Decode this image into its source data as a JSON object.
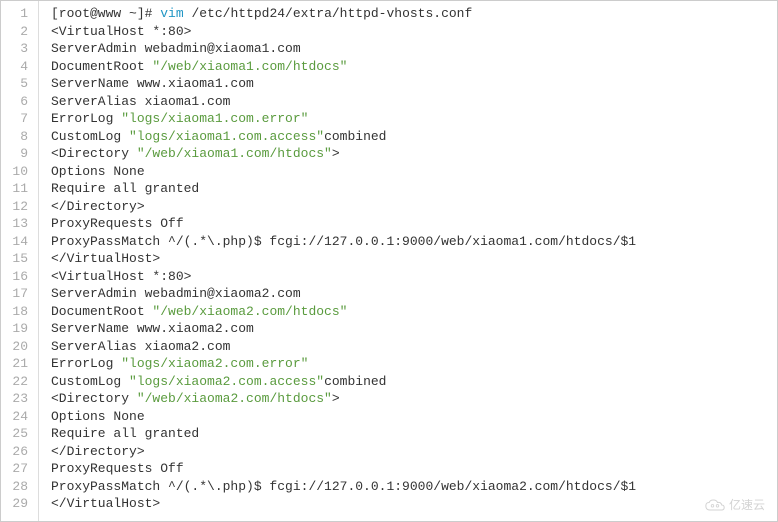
{
  "watermark": "亿速云",
  "lines": [
    {
      "num": 1,
      "segments": [
        {
          "cls": "prompt",
          "text": "[root@www ~]#"
        },
        {
          "cls": "",
          "text": " "
        },
        {
          "cls": "cmd-vim",
          "text": "vim"
        },
        {
          "cls": "",
          "text": " /etc/httpd24/extra/httpd-vhosts.conf"
        }
      ]
    },
    {
      "num": 2,
      "segments": [
        {
          "cls": "",
          "text": "<VirtualHost *:80>"
        }
      ]
    },
    {
      "num": 3,
      "segments": [
        {
          "cls": "",
          "text": "ServerAdmin webadmin@xiaoma1.com"
        }
      ]
    },
    {
      "num": 4,
      "segments": [
        {
          "cls": "",
          "text": "DocumentRoot "
        },
        {
          "cls": "string-green",
          "text": "\"/web/xiaoma1.com/htdocs\""
        }
      ]
    },
    {
      "num": 5,
      "segments": [
        {
          "cls": "",
          "text": "ServerName www.xiaoma1.com"
        }
      ]
    },
    {
      "num": 6,
      "segments": [
        {
          "cls": "",
          "text": "ServerAlias xiaoma1.com"
        }
      ]
    },
    {
      "num": 7,
      "segments": [
        {
          "cls": "",
          "text": "ErrorLog "
        },
        {
          "cls": "string-green",
          "text": "\"logs/xiaoma1.com.error\""
        }
      ]
    },
    {
      "num": 8,
      "segments": [
        {
          "cls": "",
          "text": "CustomLog "
        },
        {
          "cls": "string-green",
          "text": "\"logs/xiaoma1.com.access\""
        },
        {
          "cls": "",
          "text": "combined"
        }
      ]
    },
    {
      "num": 9,
      "segments": [
        {
          "cls": "",
          "text": "<Directory "
        },
        {
          "cls": "string-green",
          "text": "\"/web/xiaoma1.com/htdocs\""
        },
        {
          "cls": "",
          "text": ">"
        }
      ]
    },
    {
      "num": 10,
      "segments": [
        {
          "cls": "",
          "text": "Options None"
        }
      ]
    },
    {
      "num": 11,
      "segments": [
        {
          "cls": "",
          "text": "Require all granted"
        }
      ]
    },
    {
      "num": 12,
      "segments": [
        {
          "cls": "",
          "text": "</Directory>"
        }
      ]
    },
    {
      "num": 13,
      "segments": [
        {
          "cls": "",
          "text": "ProxyRequests Off"
        }
      ]
    },
    {
      "num": 14,
      "segments": [
        {
          "cls": "",
          "text": "ProxyPassMatch ^/(.*\\.php)$ fcgi://127.0.0.1:9000/web/xiaoma1.com/htdocs/$1"
        }
      ]
    },
    {
      "num": 15,
      "segments": [
        {
          "cls": "",
          "text": "</VirtualHost>"
        }
      ]
    },
    {
      "num": 16,
      "segments": [
        {
          "cls": "",
          "text": "<VirtualHost *:80>"
        }
      ]
    },
    {
      "num": 17,
      "segments": [
        {
          "cls": "",
          "text": "ServerAdmin webadmin@xiaoma2.com"
        }
      ]
    },
    {
      "num": 18,
      "segments": [
        {
          "cls": "",
          "text": "DocumentRoot "
        },
        {
          "cls": "string-green",
          "text": "\"/web/xiaoma2.com/htdocs\""
        }
      ]
    },
    {
      "num": 19,
      "segments": [
        {
          "cls": "",
          "text": "ServerName www.xiaoma2.com"
        }
      ]
    },
    {
      "num": 20,
      "segments": [
        {
          "cls": "",
          "text": "ServerAlias xiaoma2.com"
        }
      ]
    },
    {
      "num": 21,
      "segments": [
        {
          "cls": "",
          "text": "ErrorLog "
        },
        {
          "cls": "string-green",
          "text": "\"logs/xiaoma2.com.error\""
        }
      ]
    },
    {
      "num": 22,
      "segments": [
        {
          "cls": "",
          "text": "CustomLog "
        },
        {
          "cls": "string-green",
          "text": "\"logs/xiaoma2.com.access\""
        },
        {
          "cls": "",
          "text": "combined"
        }
      ]
    },
    {
      "num": 23,
      "segments": [
        {
          "cls": "",
          "text": "<Directory "
        },
        {
          "cls": "string-green",
          "text": "\"/web/xiaoma2.com/htdocs\""
        },
        {
          "cls": "",
          "text": ">"
        }
      ]
    },
    {
      "num": 24,
      "segments": [
        {
          "cls": "",
          "text": "Options None"
        }
      ]
    },
    {
      "num": 25,
      "segments": [
        {
          "cls": "",
          "text": "Require all granted"
        }
      ]
    },
    {
      "num": 26,
      "segments": [
        {
          "cls": "",
          "text": "</Directory>"
        }
      ]
    },
    {
      "num": 27,
      "segments": [
        {
          "cls": "",
          "text": "ProxyRequests Off"
        }
      ]
    },
    {
      "num": 28,
      "segments": [
        {
          "cls": "",
          "text": "ProxyPassMatch ^/(.*\\.php)$ fcgi://127.0.0.1:9000/web/xiaoma2.com/htdocs/$1"
        }
      ]
    },
    {
      "num": 29,
      "segments": [
        {
          "cls": "",
          "text": "</VirtualHost>"
        }
      ]
    }
  ]
}
